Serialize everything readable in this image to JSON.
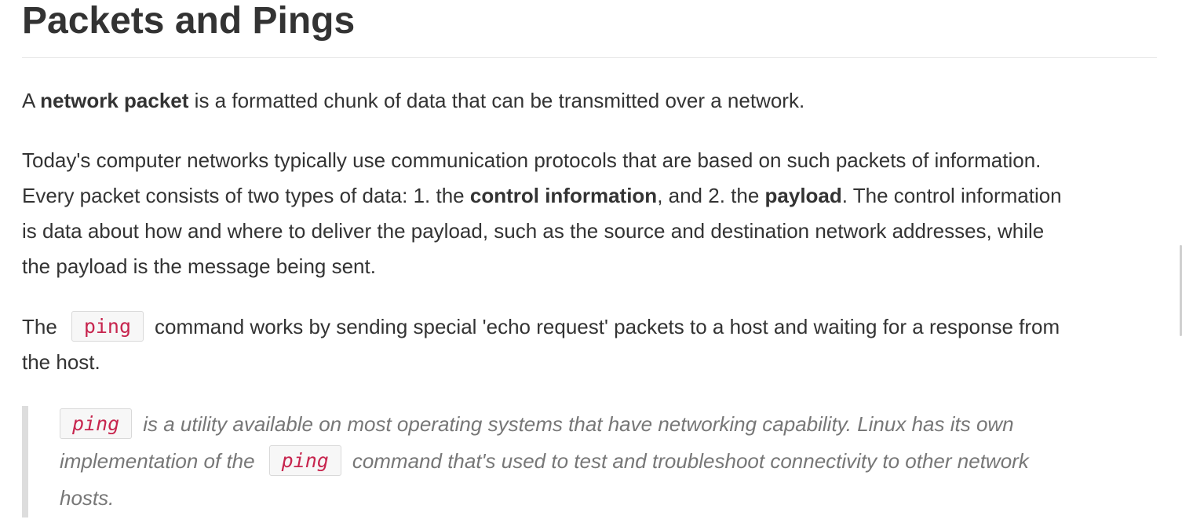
{
  "heading": "Packets and Pings",
  "p1": {
    "prefix": "A ",
    "bold": "network packet",
    "suffix": " is a formatted chunk of data that can be transmitted over a network."
  },
  "p2": {
    "line1": "Today's computer networks typically use communication protocols that are based on such packets of information.",
    "line2_a": "Every packet consists of two types of data: 1. the ",
    "line2_bold1": "control information",
    "line2_b": ", and 2. the ",
    "line2_bold2": "payload",
    "line2_c": ". The control information",
    "line3": "is data about how and where to deliver the payload, such as the source and destination network addresses, while",
    "line4": "the payload is the message being sent."
  },
  "p3": {
    "prefix": "The",
    "code": "ping",
    "line1_suffix": "command works by sending special 'echo request' packets to a host and waiting for a response from",
    "line2": "the host."
  },
  "quote": {
    "code1": "ping",
    "line1_suffix": "is a utility available on most operating systems that have networking capability. Linux has its own",
    "line2_prefix": "implementation of the",
    "code2": "ping",
    "line2_suffix": "command that's used to test and troubleshoot connectivity to other network",
    "line3": "hosts."
  }
}
